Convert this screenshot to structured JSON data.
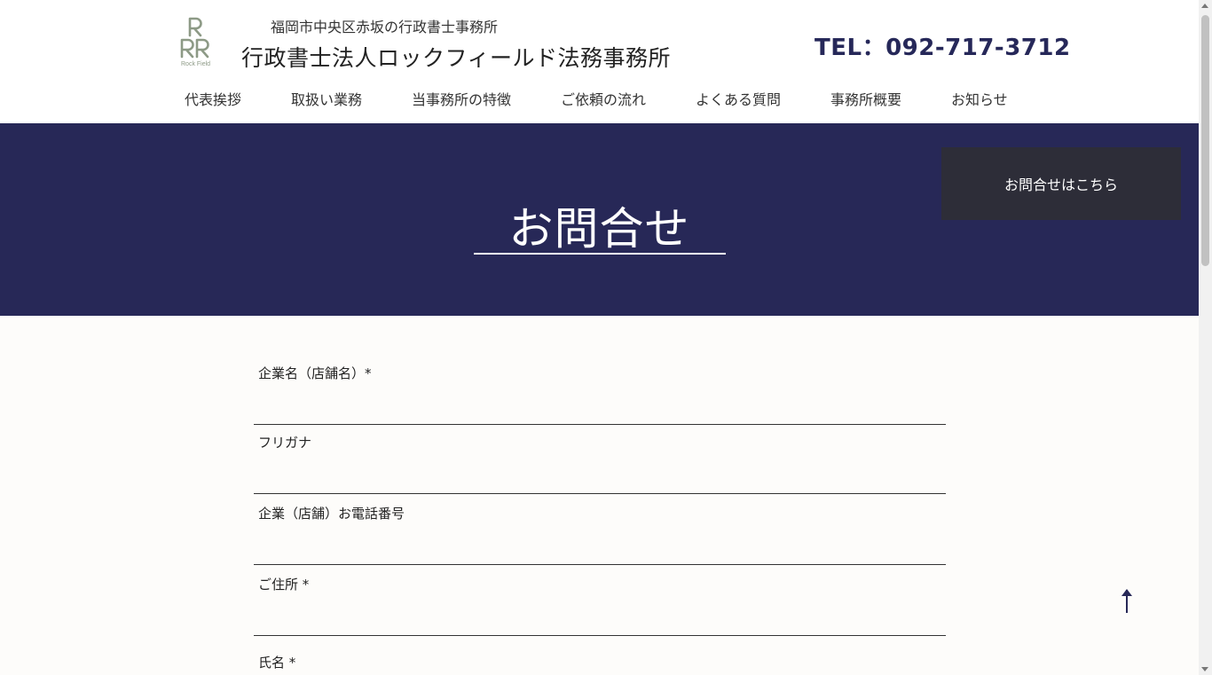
{
  "header": {
    "logo": {
      "icon": "rock-field-logo-icon",
      "text": "Rock Field",
      "color": "#8d9a86"
    },
    "tagline": "福岡市中央区赤坂の行政書士事務所",
    "title": "行政書士法人ロックフィールド法務事務所",
    "tel": "TEL：092-717-3712"
  },
  "nav": {
    "items": [
      {
        "label": "代表挨拶"
      },
      {
        "label": "取扱い業務"
      },
      {
        "label": "当事務所の特徴"
      },
      {
        "label": "ご依頼の流れ"
      },
      {
        "label": "よくある質問"
      },
      {
        "label": "事務所概要"
      },
      {
        "label": "お知らせ"
      }
    ]
  },
  "hero": {
    "title": "お問合せ",
    "cta_label": "お問合せはこちら",
    "background": "#272857"
  },
  "form": {
    "fields": [
      {
        "label": "企業名（店舗名）*",
        "value": ""
      },
      {
        "label": "フリガナ",
        "value": ""
      },
      {
        "label": "企業（店舗）お電話番号",
        "value": ""
      },
      {
        "label": "ご住所 *",
        "value": ""
      },
      {
        "label": "氏名 *",
        "value": ""
      }
    ]
  },
  "back_to_top": {
    "icon": "arrow-up-icon",
    "color": "#272857"
  },
  "colors": {
    "accent": "#272857",
    "tel": "#262859",
    "cta": "#2d2d38"
  }
}
